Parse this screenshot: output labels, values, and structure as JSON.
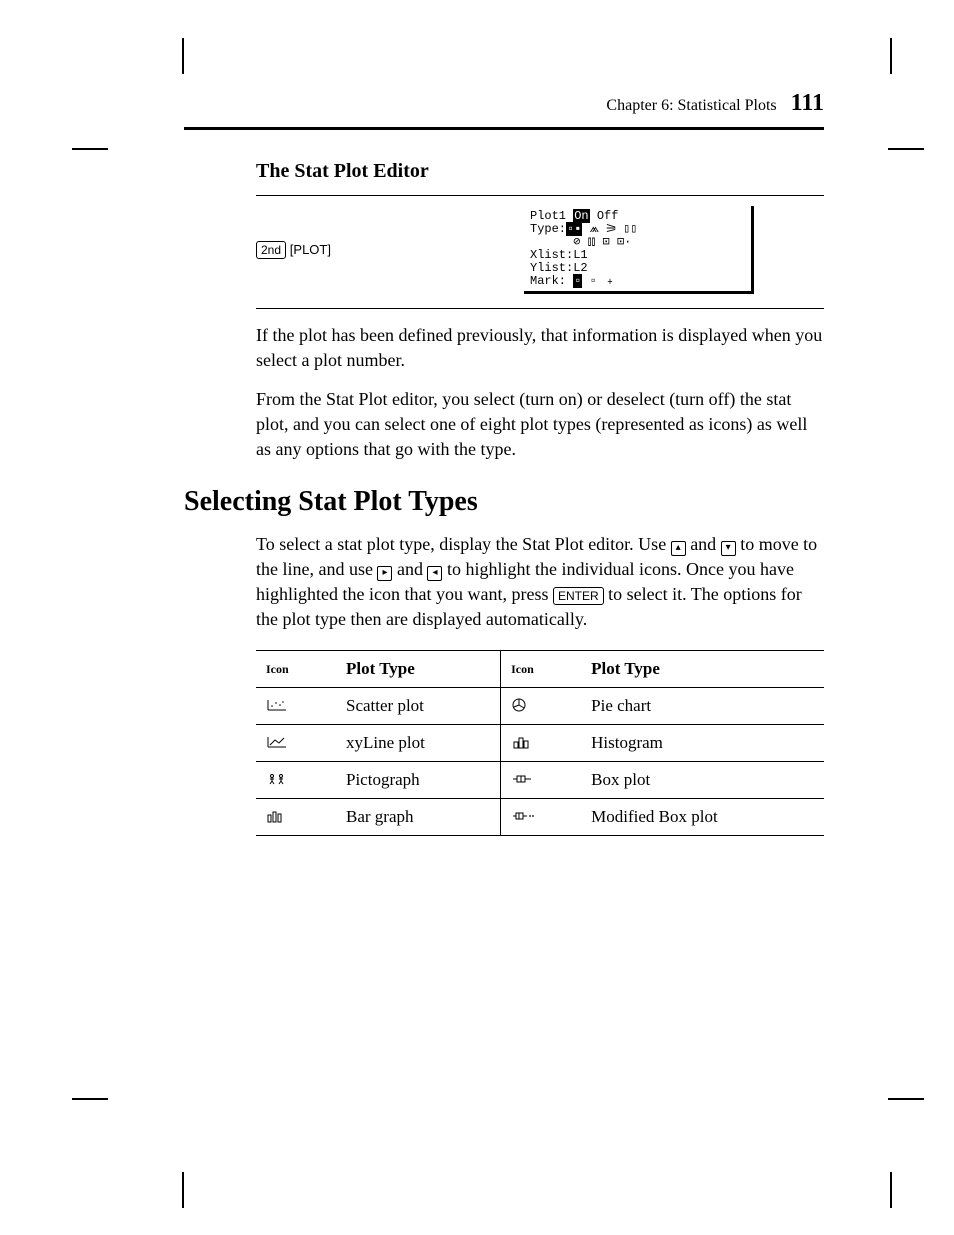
{
  "header": {
    "chapter": "Chapter 6: Statistical Plots",
    "page": "111"
  },
  "section1": {
    "title": "The Stat Plot Editor"
  },
  "keys": {
    "second": "2nd",
    "plot": "[PLOT]",
    "enter": "ENTER"
  },
  "screen": {
    "l1a": "Plot1 ",
    "l1_on": "On",
    "l1b": " Off",
    "l2": "Type:",
    "l3": "Xlist:L1",
    "l4": "Ylist:L2",
    "l5a": "Mark: ",
    "l5b": " ▫ ﹢"
  },
  "para1": "If the plot has been defined previously, that information is displayed when you select a plot number.",
  "para2": "From the Stat Plot editor, you select (turn on) or deselect (turn off) the stat plot, and you can select one of eight plot types (represented as icons) as well as any options that go with the type.",
  "section2": {
    "title": "Selecting Stat Plot Types"
  },
  "para3a": "To select a stat plot type, display the Stat Plot editor. Use ",
  "para3b": " and ",
  "para3c": " to move to the ",
  "para3d": " line, and use ",
  "para3e": " and ",
  "para3f": " to highlight the individual ",
  "para3g": " icons. Once you have highlighted the icon that you want, press ",
  "para3h": " to select it. The options for the plot type then are displayed automatically.",
  "arrows": {
    "up": "▴",
    "down": "▾",
    "right": "▸",
    "left": "◂"
  },
  "tableHead": {
    "c1": "Icon",
    "c2": "Plot Type",
    "c3": "Icon",
    "c4": "Plot Type"
  },
  "rows": [
    {
      "t1": "Scatter plot",
      "t2": "Pie chart"
    },
    {
      "t1": "xyLine plot",
      "t2": "Histogram"
    },
    {
      "t1": "Pictograph",
      "t2": "Box plot"
    },
    {
      "t1": "Bar graph",
      "t2": "Modified Box plot"
    }
  ]
}
